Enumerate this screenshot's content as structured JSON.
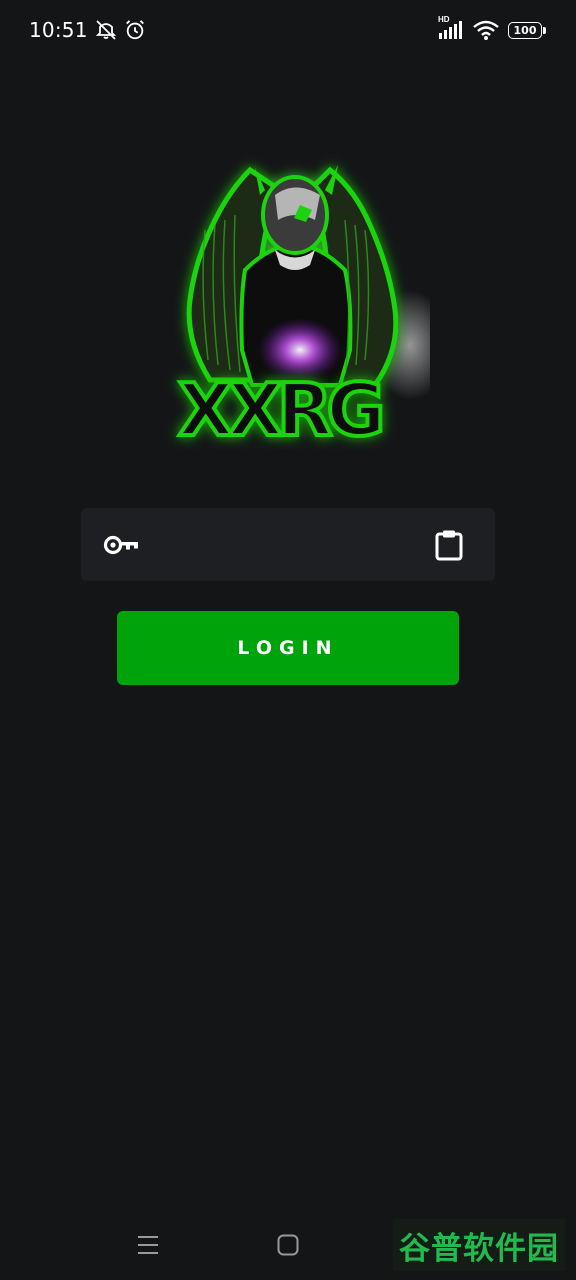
{
  "status_bar": {
    "time": "10:51",
    "network_label": "HD",
    "battery": "100"
  },
  "logo": {
    "text": "XXRG",
    "accent": "#1ed40f"
  },
  "key_field": {
    "value": "",
    "placeholder": ""
  },
  "login_button": {
    "label": "LOGIN",
    "color": "#00a30a"
  },
  "nav_bar": {
    "buttons": [
      "menu-icon",
      "home-icon",
      "back-icon"
    ]
  },
  "watermark": {
    "text": "谷普软件园"
  }
}
